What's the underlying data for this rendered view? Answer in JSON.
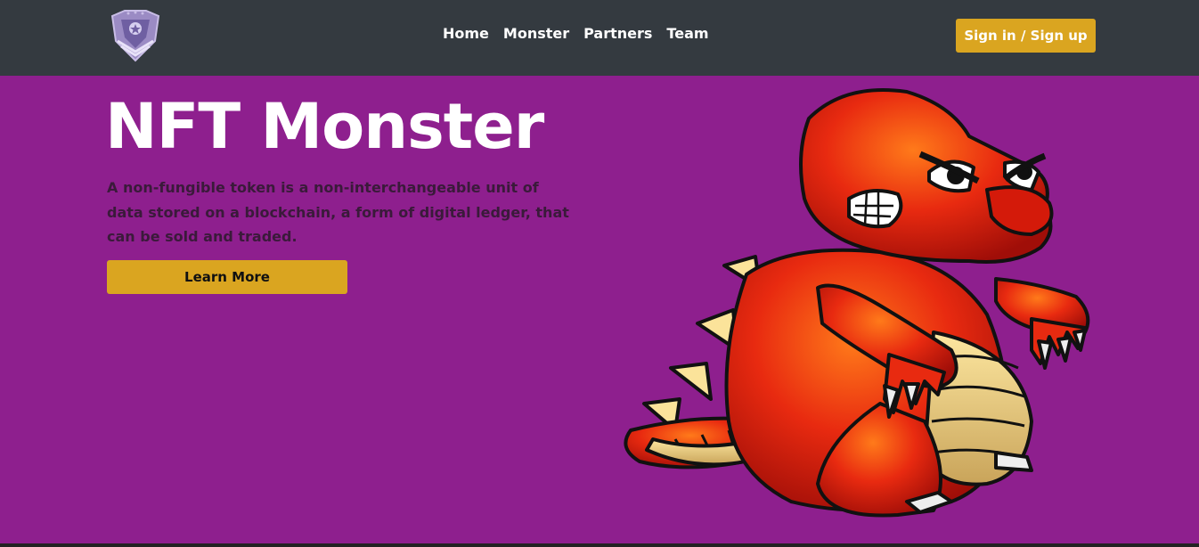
{
  "nav": {
    "links": [
      "Home",
      "Monster",
      "Partners",
      "Team"
    ],
    "signin_label": "Sign in / Sign up"
  },
  "hero": {
    "title": "NFT Monster",
    "description": "A non-fungible token is a non-interchangeable unit of data stored on a blockchain, a form of digital ledger, that can be sold and traded.",
    "button_label": "Learn More"
  },
  "icons": {
    "logo": "shield-emblem-icon",
    "illustration": "red-dinosaur-monster"
  },
  "colors": {
    "navbar": "#343a40",
    "hero_bg": "#8e1f8e",
    "accent": "#daa520"
  }
}
